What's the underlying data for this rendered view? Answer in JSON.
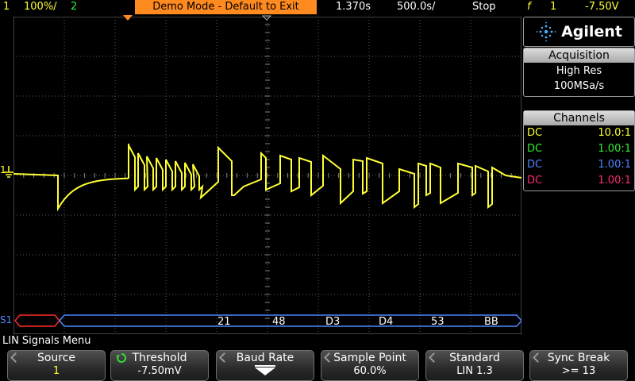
{
  "status_bar": {
    "ch1_label": "1",
    "ch1_scale": "100%/",
    "ch2_label": "2",
    "banner": "Demo Mode - Default to Exit",
    "time_offset": "1.370s",
    "time_scale": "500.0s/",
    "run_state": "Stop",
    "trigger_symbol": "f",
    "trigger_channel": "1",
    "trigger_level": "-7.50V"
  },
  "brand": {
    "name": "Agilent"
  },
  "acquisition": {
    "header": "Acquisition",
    "mode": "High Res",
    "rate": "100MSa/s"
  },
  "channels": {
    "header": "Channels",
    "rows": [
      {
        "coupling": "DC",
        "atten": "10.0:1",
        "color": "#ffff33"
      },
      {
        "coupling": "DC",
        "atten": "1.00:1",
        "color": "#33ee33"
      },
      {
        "coupling": "DC",
        "atten": "1.00:1",
        "color": "#4f84ff"
      },
      {
        "coupling": "DC",
        "atten": "1.00:1",
        "color": "#ff2a74"
      }
    ]
  },
  "serial_decode": {
    "label": "S1",
    "bytes": [
      {
        "text": "21",
        "color": "#ffff33"
      },
      {
        "text": "48",
        "color": "#ffffff"
      },
      {
        "text": "D3",
        "color": "#ffffff"
      },
      {
        "text": "D4",
        "color": "#ffffff"
      },
      {
        "text": "53",
        "color": "#ffffff"
      },
      {
        "text": "BB",
        "color": "#4f9cff"
      }
    ]
  },
  "markers": {
    "ground": "1"
  },
  "menu": {
    "title": "LIN Signals Menu",
    "softkeys": [
      {
        "label": "Source",
        "value": "1"
      },
      {
        "label": "Threshold",
        "value": "-7.50mV"
      },
      {
        "label": "Baud Rate",
        "value": ""
      },
      {
        "label": "Sample Point",
        "value": "60.0%"
      },
      {
        "label": "Standard",
        "value": "LIN 1.3"
      },
      {
        "label": "Sync Break",
        "value": ">= 13"
      }
    ]
  },
  "colors": {
    "ch1": "#ffff33",
    "serial": "#4f84ff",
    "error": "#ff2a2a",
    "banner": "#ff8a1f"
  }
}
